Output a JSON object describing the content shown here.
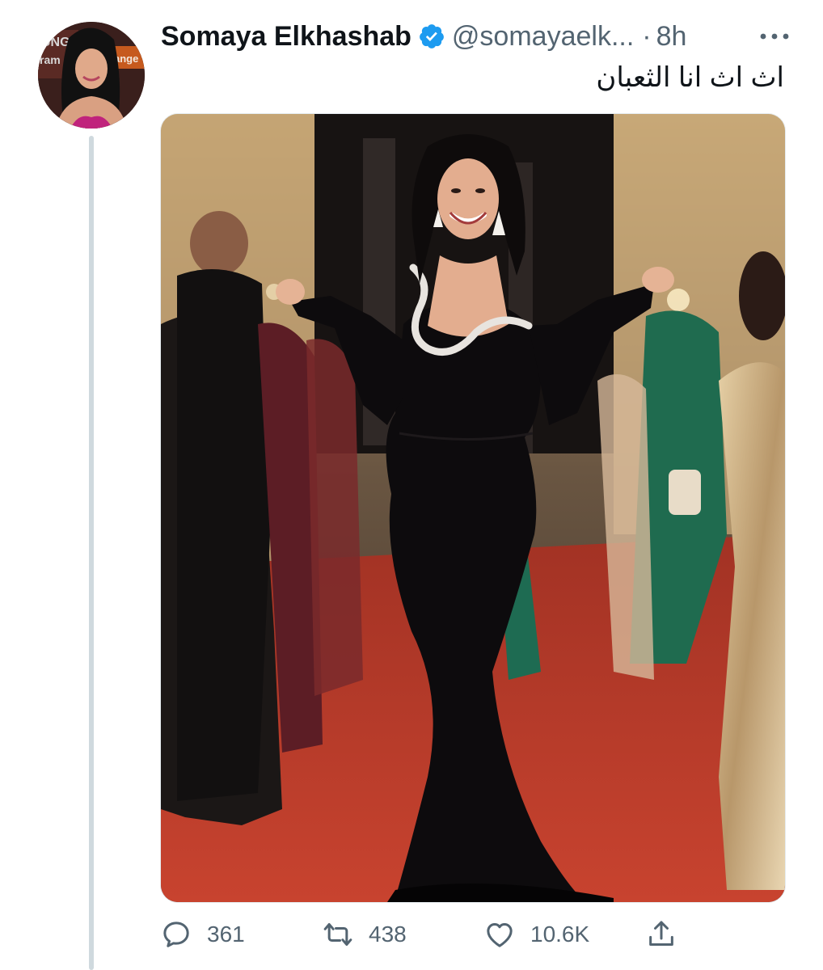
{
  "tweet": {
    "display_name": "Somaya Elkhashab",
    "handle": "@somayaelk...",
    "separator": "·",
    "time": "8h",
    "text": "اث اث انا الثعبان",
    "verified_icon": "verified-badge-icon",
    "more_icon": "more-horizontal-icon"
  },
  "avatar": {
    "backdrop_lettering": [
      "UNG",
      "ram",
      "ange"
    ]
  },
  "actions": {
    "reply_count": "361",
    "retweet_count": "438",
    "like_count": "10.6K",
    "icons": [
      "reply-icon",
      "retweet-icon",
      "like-icon",
      "share-icon"
    ]
  },
  "colors": {
    "text_primary": "#0f1419",
    "text_secondary": "#536471",
    "verified_blue": "#1d9bf0",
    "thread_line": "#cfd9de",
    "red_carpet": "#c2412f",
    "dress": "#0d0b0d"
  }
}
